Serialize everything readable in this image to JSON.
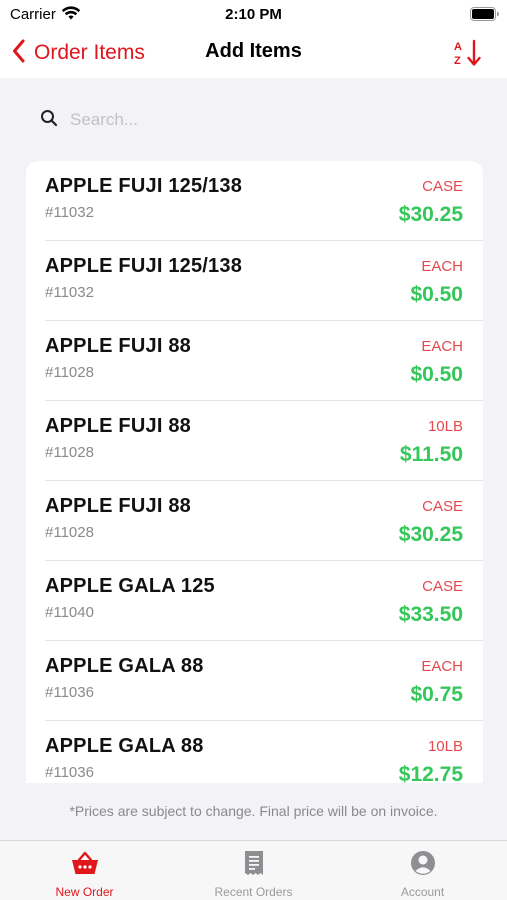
{
  "status_bar": {
    "carrier": "Carrier",
    "time": "2:10 PM"
  },
  "nav": {
    "back_label": "Order Items",
    "title": "Add Items",
    "sort_icon": "sort-az-icon"
  },
  "search": {
    "placeholder": "Search...",
    "value": ""
  },
  "items": [
    {
      "name": "APPLE FUJI 125/138",
      "sku": "#11032",
      "unit": "CASE",
      "price": "$30.25"
    },
    {
      "name": "APPLE FUJI 125/138",
      "sku": "#11032",
      "unit": "EACH",
      "price": "$0.50"
    },
    {
      "name": "APPLE FUJI 88",
      "sku": "#11028",
      "unit": "EACH",
      "price": "$0.50"
    },
    {
      "name": "APPLE FUJI 88",
      "sku": "#11028",
      "unit": "10LB",
      "price": "$11.50"
    },
    {
      "name": "APPLE FUJI 88",
      "sku": "#11028",
      "unit": "CASE",
      "price": "$30.25"
    },
    {
      "name": "APPLE GALA 125",
      "sku": "#11040",
      "unit": "CASE",
      "price": "$33.50"
    },
    {
      "name": "APPLE GALA 88",
      "sku": "#11036",
      "unit": "EACH",
      "price": "$0.75"
    },
    {
      "name": "APPLE GALA 88",
      "sku": "#11036",
      "unit": "10LB",
      "price": "$12.75"
    }
  ],
  "footer_note": "*Prices are subject to change. Final price will be on invoice.",
  "tabs": [
    {
      "label": "New Order",
      "icon": "basket-icon",
      "active": true
    },
    {
      "label": "Recent Orders",
      "icon": "receipt-icon",
      "active": false
    },
    {
      "label": "Account",
      "icon": "person-icon",
      "active": false
    }
  ],
  "colors": {
    "accent": "#e0161d",
    "unit": "#e5484d",
    "price": "#34c759",
    "secondary_text": "#8a8a8e"
  }
}
